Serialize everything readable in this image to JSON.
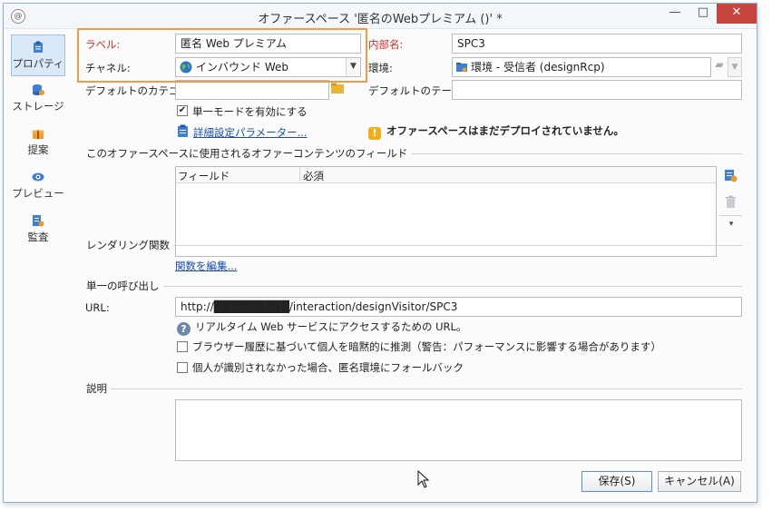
{
  "window": {
    "app_icon": "@",
    "title": "オファースペース '匿名のWebプレミアム ()' *",
    "minimize": "—",
    "maximize": "□",
    "close": "✕"
  },
  "sidebar": {
    "items": [
      {
        "label": "プロパティ",
        "icon": "clipboard-icon",
        "active": true
      },
      {
        "label": "ストレージ",
        "icon": "database-icon"
      },
      {
        "label": "提案",
        "icon": "gift-icon"
      },
      {
        "label": "プレビュー",
        "icon": "eye-icon"
      },
      {
        "label": "監査",
        "icon": "audit-icon"
      }
    ]
  },
  "form": {
    "label_label": "ラベル:",
    "label_value": "匿名 Web プレミアム",
    "internal_name_label": "内部名:",
    "internal_name_value": "SPC3",
    "channel_label": "チャネル:",
    "channel_value": "インバウンド Web",
    "environment_label": "環境:",
    "environment_value": "環境 - 受信者 (designRcp)",
    "default_category_label": "デフォルトのカテゴリ:",
    "default_category_value": "",
    "default_theme_label": "デフォルトのテーマ:",
    "default_theme_value": "",
    "single_mode_label": "単一モードを有効にする",
    "single_mode_checked": "✔",
    "advanced_params_link": "詳細設定パラメーター...",
    "deploy_warning": "オファースペースはまだデプロイされていません。",
    "warning_glyph": "!"
  },
  "fields_section": {
    "title": "このオファースペースに使用されるオファーコンテンツのフィールド",
    "columns": [
      "フィールド",
      "必須"
    ],
    "more_glyph": "▾"
  },
  "rendering_section": {
    "title": "レンダリング関数",
    "edit_link": "関数を編集..."
  },
  "single_call_section": {
    "title": "単一の呼び出し",
    "url_label": "URL:",
    "url_value": "http://█████████/interaction/designVisitor/SPC3",
    "help_text": "リアルタイム Web サービスにアクセスするための URL。",
    "help_glyph": "?",
    "browser_history_label": "ブラウザー履歴に基づいて個人を暗黙的に推測（警告：パフォーマンスに影響する場合があります）",
    "fallback_label": "個人が識別されなかった場合、匿名環境にフォールバック"
  },
  "description_section": {
    "title": "説明",
    "value": ""
  },
  "footer": {
    "save_label": "保存(S)",
    "cancel_label": "キャンセル(A)"
  },
  "colors": {
    "highlight": "#ef9c44",
    "required_label": "#d22a2a",
    "link": "#1a4fa8",
    "close_button": "#c7453f"
  }
}
